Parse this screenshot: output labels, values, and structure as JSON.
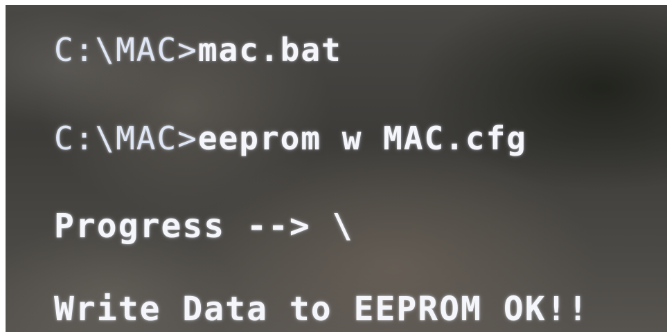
{
  "terminal": {
    "lines": [
      {
        "prompt": "C:\\MAC>",
        "command": "mac.bat"
      },
      {
        "prompt": "C:\\MAC>",
        "command": "eeprom w MAC.cfg"
      },
      {
        "text": "Progress --> \\"
      },
      {
        "text": "Write Data to EEPROM OK!!"
      }
    ]
  }
}
